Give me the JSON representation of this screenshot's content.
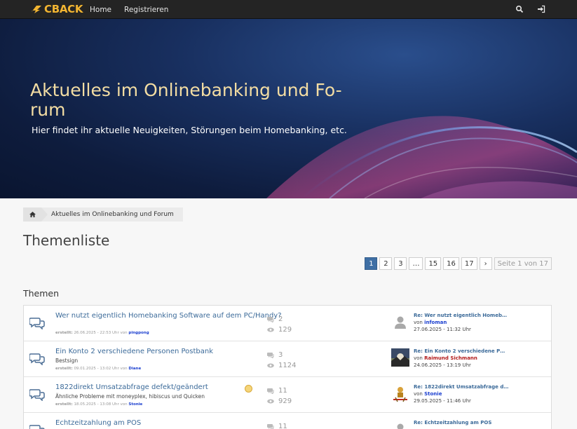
{
  "nav": {
    "logo_text": "CBACK",
    "links": [
      "Home",
      "Registrieren"
    ],
    "search_icon": "search-icon",
    "login_icon": "sign-in-icon"
  },
  "hero": {
    "title": "Aktuelles im Onlinebanking und Fo-rum",
    "subtitle": "Hier findet ihr aktuelle Neuigkeiten, Störungen beim Homebanking, etc."
  },
  "breadcrumb": {
    "home_icon": "home-icon",
    "item": "Aktuelles im Onlinebanking und Forum"
  },
  "page_title": "Themenliste",
  "pagination": {
    "pages": [
      "1",
      "2",
      "3",
      "…",
      "15",
      "16",
      "17"
    ],
    "next": "›",
    "info": "Seite 1 von 17",
    "active": "1"
  },
  "section_title": "Themen",
  "topics": [
    {
      "title": "Wer nutzt eigentlich Homebanking Software auf dem PC/Handy?",
      "description": "",
      "created_label": "erstellt:",
      "created": "26.06.2025 - 22:53 Uhr",
      "by_label": "von",
      "author": "pingpong",
      "replies": "2",
      "views": "129",
      "last_title": "Re: Wer nutzt eigentlich Homeb…",
      "last_by_label": "von",
      "last_user": "infoman",
      "last_date": "27.06.2025 - 11:32 Uhr"
    },
    {
      "title": "Ein Konto 2 verschiedene Personen Postbank",
      "description": "Bestsign",
      "created_label": "erstellt:",
      "created": "09.01.2025 - 13:02 Uhr",
      "by_label": "von",
      "author": "Diane",
      "replies": "3",
      "views": "1124",
      "last_title": "Re: Ein Konto 2 verschiedene P…",
      "last_by_label": "von",
      "last_user": "Raimund Sichmann",
      "last_date": "24.06.2025 - 13:19 Uhr"
    },
    {
      "title": "1822direkt Umsatzabfrage defekt/geändert",
      "description": "Ähnliche Probleme mit moneyplex, hibiscus und Quicken",
      "created_label": "erstellt:",
      "created": "18.05.2025 - 13:08 Uhr",
      "by_label": "von",
      "author": "Stonie",
      "replies": "11",
      "views": "929",
      "last_title": "Re: 1822direkt Umsatzabfrage d…",
      "last_by_label": "von",
      "last_user": "Stonie",
      "last_date": "29.05.2025 - 11:46 Uhr"
    },
    {
      "title": "Echtzeitzahlung am POS",
      "description": "",
      "created_label": "",
      "created": "",
      "by_label": "",
      "author": "",
      "replies": "11",
      "views": "",
      "last_title": "Re: Echtzeitzahlung am POS",
      "last_by_label": "",
      "last_user": "",
      "last_date": ""
    }
  ],
  "colors": {
    "navbar": "#242424",
    "logo": "#f2b531",
    "hero_title": "#f3dda3",
    "link": "#3b6a99",
    "active_page": "#3f6fa4",
    "user_blue": "#1a3ecf",
    "user_red": "#b21a1a"
  }
}
